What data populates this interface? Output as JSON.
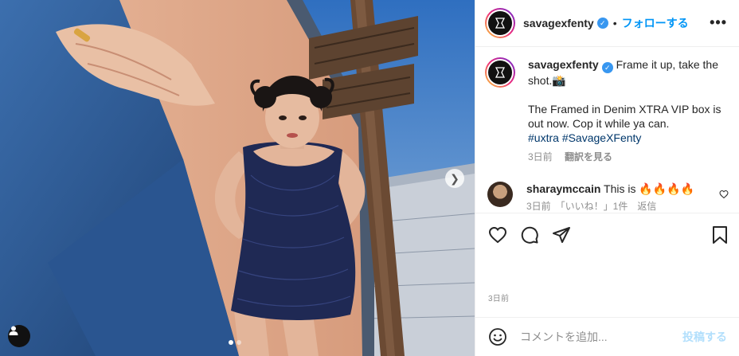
{
  "post": {
    "username": "savagexfenty",
    "follow_label": "フォローする",
    "separator": "•",
    "more_label": "•••",
    "caption": {
      "line1": "Frame it up, take the shot.",
      "emoji": "📸",
      "line2": "The Framed in Denim XTRA VIP box is out now. Cop it while ya can.",
      "hashtags": [
        "#uxtra",
        "#SavageXFenty"
      ],
      "time": "3日前",
      "translate": "翻訳を見る"
    },
    "comment": {
      "username": "sharaymccain",
      "text": "This is 🔥🔥🔥🔥",
      "meta": "3日前　「いいね！」1件　返信"
    },
    "date": "3日前",
    "add_comment": {
      "placeholder": "コメントを追加...",
      "post_label": "投稿する"
    }
  },
  "media": {
    "carousel_count": 2,
    "carousel_active": 1,
    "next_icon": "chevron-right-icon",
    "tag_icon": "user-tag-icon"
  },
  "colors": {
    "accent": "#0095f6",
    "link": "#00376b",
    "muted": "#8e8e8e",
    "post_disabled": "#b2dffc"
  }
}
